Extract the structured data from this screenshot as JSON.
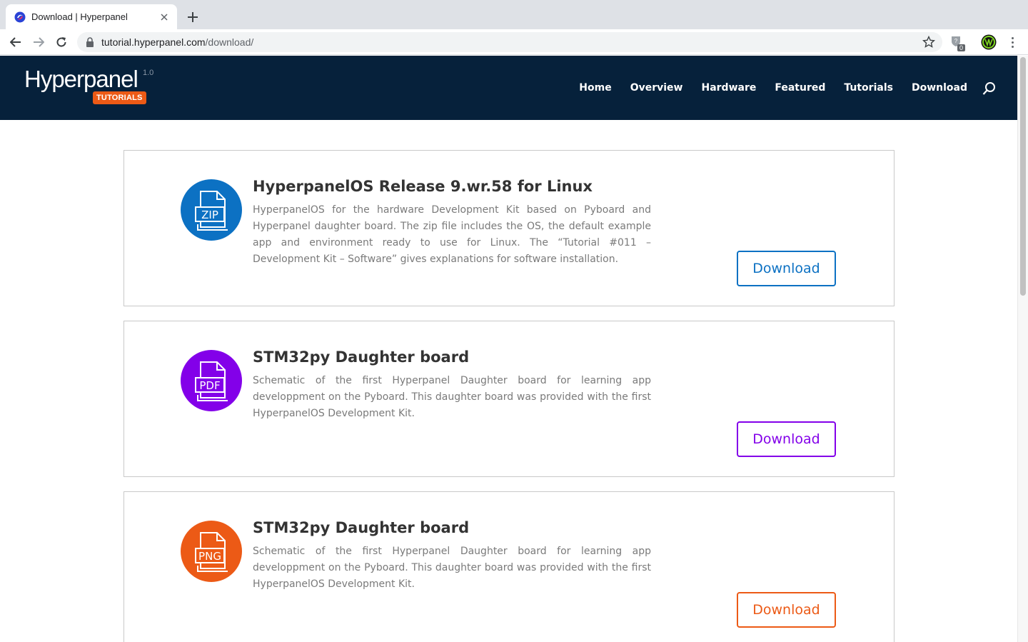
{
  "browser": {
    "tab_title": "Download | Hyperpanel",
    "url_host": "tutorial.hyperpanel.com",
    "url_path": "/download/",
    "extension_badge": "0"
  },
  "site": {
    "logo_word": "Hyperpanel",
    "logo_version": "1.0",
    "logo_badge": "TUTORIALS",
    "nav": [
      "Home",
      "Overview",
      "Hardware",
      "Featured",
      "Tutorials",
      "Download"
    ]
  },
  "downloads": [
    {
      "title": "HyperpanelOS Release 9.wr.58 for Linux",
      "description": "HyperpanelOS for the hardware Development Kit based on Pyboard and Hyperpanel daughter board. The zip file includes the OS, the default example app and environment ready to use for Linux. The “Tutorial #011 – Development Kit – Software” gives explanations for software installation.",
      "file_type": "ZIP",
      "icon": "zip-file-icon",
      "color": "#0c71c3",
      "button": "Download"
    },
    {
      "title": "STM32py Daughter board",
      "description": "Schematic of the first Hyperpanel Daughter board for learning app developpment on the Pyboard. This daughter board was provided with the first HyperpanelOS Development Kit.",
      "file_type": "PDF",
      "icon": "pdf-file-icon",
      "color": "#8300e9",
      "button": "Download"
    },
    {
      "title": "STM32py Daughter board",
      "description": "Schematic of the first Hyperpanel Daughter board for learning app developpment on the Pyboard. This daughter board was provided with the first HyperpanelOS Development Kit.",
      "file_type": "PNG",
      "icon": "png-file-icon",
      "color": "#ec5a16",
      "button": "Download"
    }
  ],
  "colors": {
    "header_bg": "#06213b",
    "zip": "#0c71c3",
    "pdf": "#8300e9",
    "png": "#ec5a16"
  }
}
